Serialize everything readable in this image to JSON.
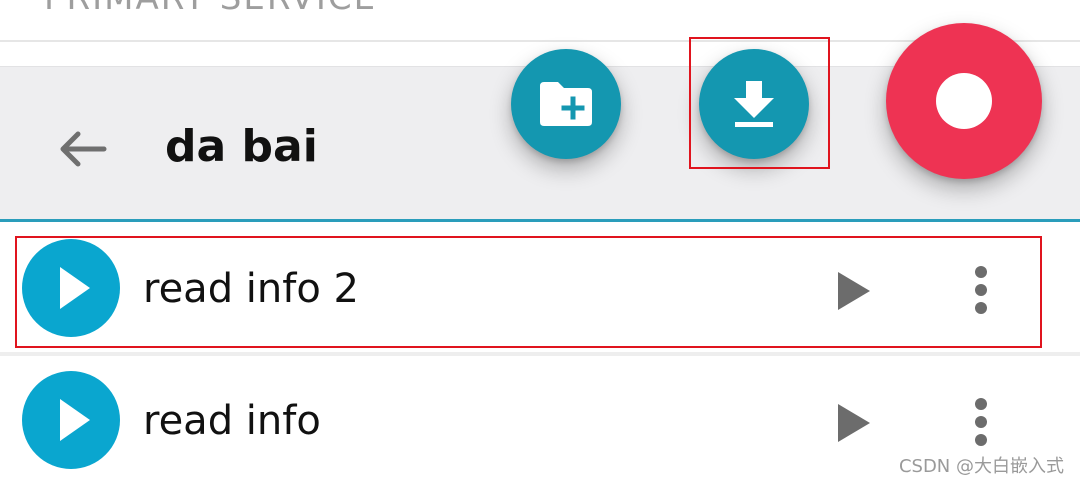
{
  "section_header": {
    "label": "PRIMARY SERVICE"
  },
  "toolbar": {
    "title": "da bai",
    "back_icon": "arrow-left-icon",
    "actions": [
      {
        "icon": "folder-plus-icon",
        "color": "#1497b0"
      },
      {
        "icon": "download-icon",
        "color": "#1497b0"
      },
      {
        "icon": "record-icon",
        "color": "#ee3353"
      }
    ],
    "divider_color": "#2a9dbb"
  },
  "list": {
    "items": [
      {
        "label": "read info 2",
        "leading_icon": "play-circle-icon",
        "trailing_icons": [
          "play-icon",
          "more-vert-icon"
        ]
      },
      {
        "label": "read info",
        "leading_icon": "play-circle-icon",
        "trailing_icons": [
          "play-icon",
          "more-vert-icon"
        ]
      }
    ],
    "accent_color": "#0aa6cf"
  },
  "annotations": {
    "highlight_color": "#e0141e"
  },
  "watermark": {
    "text": "CSDN @大白嵌入式"
  }
}
